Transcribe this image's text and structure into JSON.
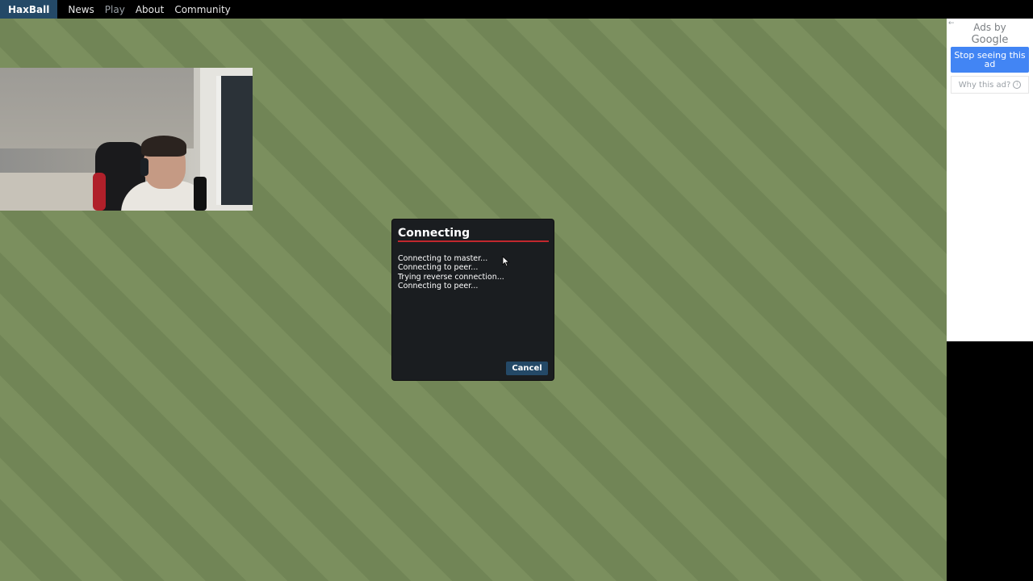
{
  "nav": {
    "brand": "HaxBall",
    "items": [
      "News",
      "Play",
      "About",
      "Community"
    ],
    "active_item": "Play"
  },
  "dialog": {
    "title": "Connecting",
    "log": [
      "Connecting to master...",
      "Connecting to peer...",
      "Trying reverse connection...",
      "Connecting to peer..."
    ],
    "cancel_label": "Cancel"
  },
  "ad": {
    "ads_by": "Ads by",
    "google": "Google",
    "stop_label": "Stop seeing this ad",
    "why_label": "Why this ad?",
    "back_icon": "←"
  },
  "colors": {
    "field": "#7a8e5d",
    "brand": "#244967",
    "dialog_bg": "#1a1d20",
    "accent_red": "#c1272d",
    "ad_button": "#4285f4"
  },
  "icons": [
    "back-arrow-icon",
    "info-icon",
    "mouse-cursor-icon"
  ]
}
